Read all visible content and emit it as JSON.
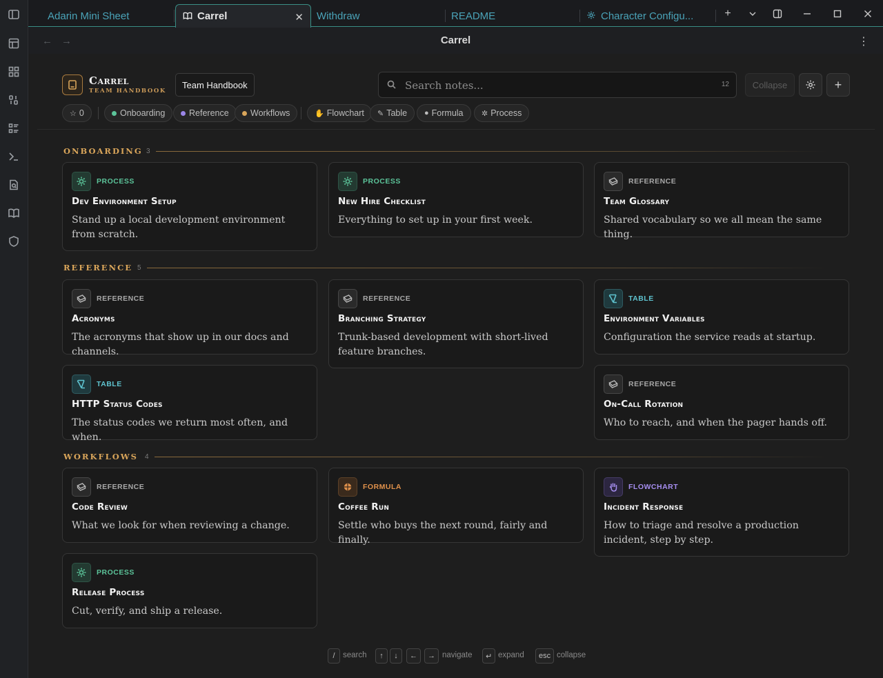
{
  "tabs": [
    {
      "label": "Adarin Mini Sheet"
    },
    {
      "label": "Carrel"
    },
    {
      "label": "Withdraw"
    },
    {
      "label": "README"
    },
    {
      "label": "Character Configu..."
    }
  ],
  "view": {
    "title": "Carrel"
  },
  "brand": {
    "title": "Carrel",
    "subtitle": "TEAM HANDBOOK",
    "tooltip": "Team Handbook"
  },
  "search": {
    "placeholder": "Search notes...",
    "count": "12"
  },
  "toolbar": {
    "collapse_label": "Collapse"
  },
  "chips": {
    "favorites": "0",
    "groups": [
      {
        "label": "Onboarding",
        "color": "#5cc49a"
      },
      {
        "label": "Reference",
        "color": "#9b86e8"
      },
      {
        "label": "Workflows",
        "color": "#d9a55a"
      }
    ],
    "types": [
      {
        "label": "Flowchart"
      },
      {
        "label": "Table"
      },
      {
        "label": "Formula"
      },
      {
        "label": "Process"
      }
    ]
  },
  "sections": [
    {
      "title": "ONBOARDING",
      "count": "3",
      "cards": [
        {
          "type": "PROCESS",
          "title": "Dev Environment Setup",
          "desc": "Stand up a local development environment from scratch."
        },
        {
          "type": "PROCESS",
          "title": "New Hire Checklist",
          "desc": "Everything to set up in your first week."
        },
        {
          "type": "REFERENCE",
          "title": "Team Glossary",
          "desc": "Shared vocabulary so we all mean the same thing."
        }
      ]
    },
    {
      "title": "REFERENCE",
      "count": "5",
      "cards": [
        {
          "type": "REFERENCE",
          "title": "Acronyms",
          "desc": "The acronyms that show up in our docs and channels."
        },
        {
          "type": "REFERENCE",
          "title": "Branching Strategy",
          "desc": "Trunk-based development with short-lived feature branches."
        },
        {
          "type": "TABLE",
          "title": "Environment Variables",
          "desc": "Configuration the service reads at startup."
        },
        {
          "type": "TABLE",
          "title": "HTTP Status Codes",
          "desc": "The status codes we return most often, and when."
        },
        {
          "type": "REFERENCE",
          "title": "On-Call Rotation",
          "desc": "Who to reach, and when the pager hands off."
        }
      ]
    },
    {
      "title": "WORKFLOWS",
      "count": "4",
      "cards": [
        {
          "type": "REFERENCE",
          "title": "Code Review",
          "desc": "What we look for when reviewing a change."
        },
        {
          "type": "FORMULA",
          "title": "Coffee Run",
          "desc": "Settle who buys the next round, fairly and finally."
        },
        {
          "type": "FLOWCHART",
          "title": "Incident Response",
          "desc": "How to triage and resolve a production incident, step by step."
        },
        {
          "type": "PROCESS",
          "title": "Release Process",
          "desc": "Cut, verify, and ship a release."
        }
      ]
    }
  ],
  "footer": {
    "keys": {
      "search": "/",
      "up": "↑",
      "down": "↓",
      "left": "←",
      "right": "→",
      "enter": "↵",
      "esc": "esc"
    },
    "labels": {
      "search": "search",
      "navigate": "navigate",
      "expand": "expand",
      "collapse": "collapse"
    }
  }
}
